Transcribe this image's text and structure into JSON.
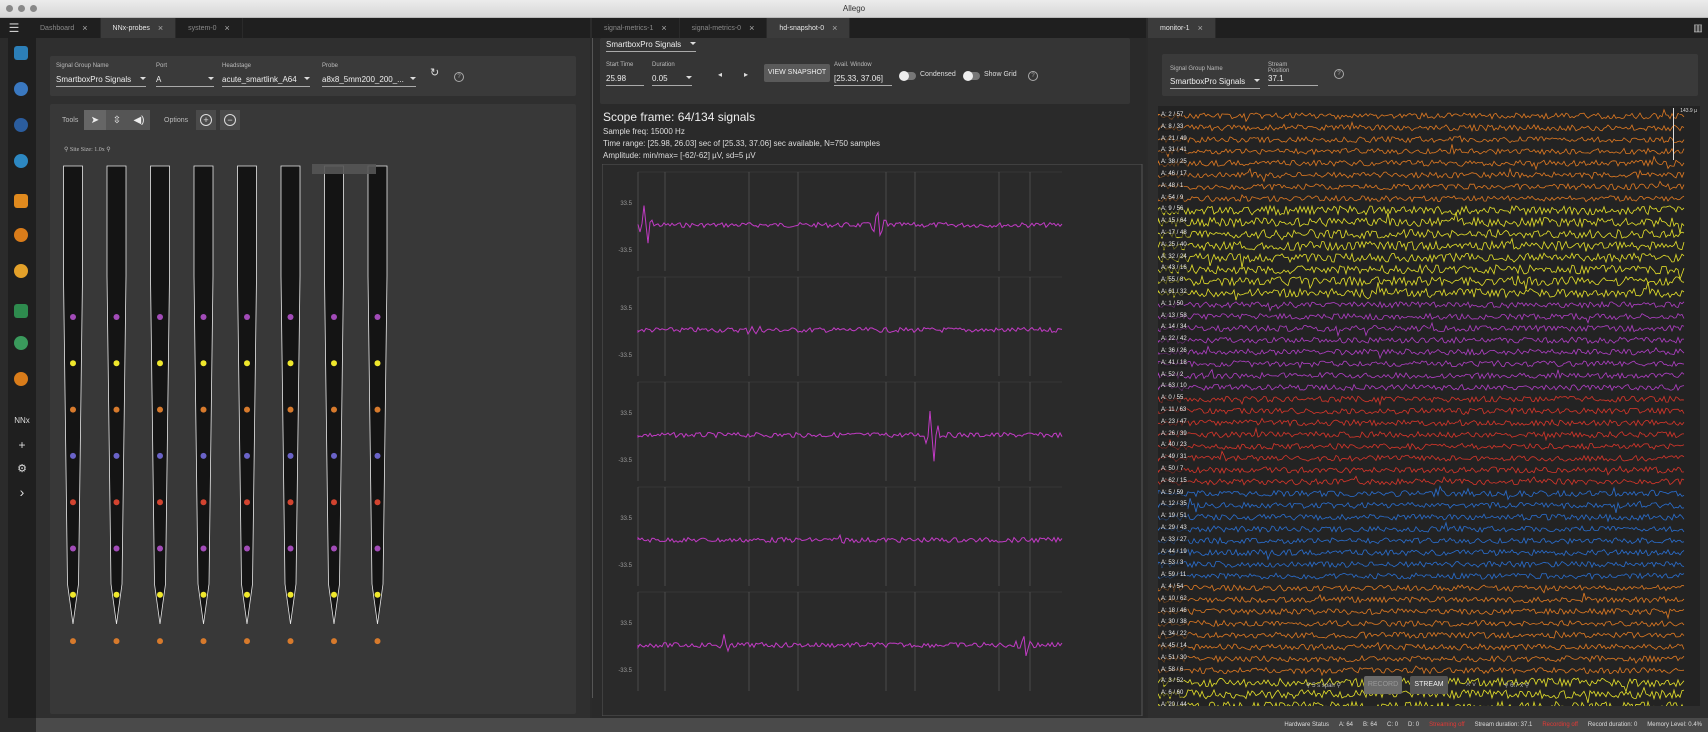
{
  "window": {
    "title": "Allego"
  },
  "tabs_left": [
    {
      "label": "Dashboard",
      "active": false
    },
    {
      "label": "NNx-probes",
      "active": true
    },
    {
      "label": "system-0",
      "active": false
    }
  ],
  "tabs_mid": [
    {
      "label": "signal-metrics-1",
      "active": false
    },
    {
      "label": "signal-metrics-0",
      "active": false
    },
    {
      "label": "hd-snapshot-0",
      "active": true
    }
  ],
  "tabs_right": [
    {
      "label": "monitor-1",
      "active": true
    }
  ],
  "sidebar": {
    "nnx_label": "NNx",
    "add_label": "+",
    "settings_label": "⚙",
    "expand_label": "›"
  },
  "probe_panel": {
    "signal_group_label": "Signal Group Name",
    "signal_group_value": "SmartboxPro Signals",
    "port_label": "Port",
    "port_value": "A",
    "headstage_label": "Headstage",
    "headstage_value": "acute_smartlink_A64",
    "probe_label": "Probe",
    "probe_value": "a8x8_5mm200_200_...",
    "tools_label": "Tools",
    "options_label": "Options",
    "site_size_label": "Site Size: 1.0x",
    "shank_count": 8,
    "site_colors": [
      "#a24bb8",
      "#f0e82c",
      "#d77a2c",
      "#6a63c8",
      "#d2432f",
      "#a24bb8",
      "#f0e82c",
      "#d77a2c"
    ]
  },
  "snapshot_panel": {
    "signal_group_value": "SmartboxPro Signals",
    "start_time_label": "Start Time",
    "start_time_value": "25.98",
    "duration_label": "Duration",
    "duration_value": "0.05",
    "view_snapshot_label": "VIEW SNAPSHOT",
    "avail_window_label": "Avail. Window",
    "avail_window_value": "[25.33, 37.06]",
    "condensed_label": "Condensed",
    "show_grid_label": "Show Grid",
    "scope_title": "Scope frame: 64/134 signals",
    "sample_freq": "Sample freq: 15000 Hz",
    "time_range": "Time range: [25.98, 26.03] sec of [25.33, 37.06] sec available, N=750 samples",
    "amplitude": "Amplitude: min/max= [-62/-62] µV, sd=5 µV",
    "y_tick_top": "33.5",
    "y_tick_bottom": "-33.5",
    "trace_color": "#c13bc4",
    "subplot_count": 5
  },
  "monitor_panel": {
    "signal_group_label": "Signal Group Name",
    "signal_group_value": "SmartboxPro Signals",
    "stream_position_label": "Stream Position",
    "stream_position_value": "37.1",
    "scale_top": "143.9 µ",
    "channels": [
      {
        "label": "A: 2 / 57",
        "color": "#e07a22"
      },
      {
        "label": "A: 8 / 33",
        "color": "#e07a22"
      },
      {
        "label": "A: 21 / 49",
        "color": "#e07a22"
      },
      {
        "label": "A: 31 / 41",
        "color": "#e07a22"
      },
      {
        "label": "A: 38 / 25",
        "color": "#e07a22"
      },
      {
        "label": "A: 46 / 17",
        "color": "#e07a22"
      },
      {
        "label": "A: 48 / 1",
        "color": "#e07a22"
      },
      {
        "label": "A: 54 / 9",
        "color": "#e07a22"
      },
      {
        "label": "A: 9 / 56",
        "color": "#e6e22a"
      },
      {
        "label": "A: 15 / 64",
        "color": "#e6e22a"
      },
      {
        "label": "A: 17 / 48",
        "color": "#e6e22a"
      },
      {
        "label": "A: 25 / 40",
        "color": "#e6e22a"
      },
      {
        "label": "A: 32 / 24",
        "color": "#e6e22a"
      },
      {
        "label": "A: 43 / 16",
        "color": "#e6e22a"
      },
      {
        "label": "A: 55 / 8",
        "color": "#e6e22a"
      },
      {
        "label": "A: 61 / 32",
        "color": "#e6e22a"
      },
      {
        "label": "A: 1 / 50",
        "color": "#b13fc6"
      },
      {
        "label": "A: 13 / 58",
        "color": "#b13fc6"
      },
      {
        "label": "A: 14 / 34",
        "color": "#b13fc6"
      },
      {
        "label": "A: 22 / 42",
        "color": "#b13fc6"
      },
      {
        "label": "A: 36 / 26",
        "color": "#b13fc6"
      },
      {
        "label": "A: 41 / 18",
        "color": "#b13fc6"
      },
      {
        "label": "A: 52 / 2",
        "color": "#b13fc6"
      },
      {
        "label": "A: 63 / 10",
        "color": "#b13fc6"
      },
      {
        "label": "A: 0 / 55",
        "color": "#d9362a"
      },
      {
        "label": "A: 11 / 63",
        "color": "#d9362a"
      },
      {
        "label": "A: 23 / 47",
        "color": "#d9362a"
      },
      {
        "label": "A: 26 / 39",
        "color": "#d9362a"
      },
      {
        "label": "A: 40 / 23",
        "color": "#d9362a"
      },
      {
        "label": "A: 49 / 31",
        "color": "#d9362a"
      },
      {
        "label": "A: 50 / 7",
        "color": "#d9362a"
      },
      {
        "label": "A: 62 / 15",
        "color": "#d9362a"
      },
      {
        "label": "A: 5 / 59",
        "color": "#2a6fd1"
      },
      {
        "label": "A: 12 / 35",
        "color": "#2a6fd1"
      },
      {
        "label": "A: 19 / 51",
        "color": "#2a6fd1"
      },
      {
        "label": "A: 29 / 43",
        "color": "#2a6fd1"
      },
      {
        "label": "A: 33 / 27",
        "color": "#2a6fd1"
      },
      {
        "label": "A: 44 / 19",
        "color": "#2a6fd1"
      },
      {
        "label": "A: 53 / 3",
        "color": "#2a6fd1"
      },
      {
        "label": "A: 59 / 11",
        "color": "#2a6fd1"
      },
      {
        "label": "A: 4 / 54",
        "color": "#e07a22"
      },
      {
        "label": "A: 10 / 62",
        "color": "#e07a22"
      },
      {
        "label": "A: 18 / 46",
        "color": "#e07a22"
      },
      {
        "label": "A: 30 / 38",
        "color": "#e07a22"
      },
      {
        "label": "A: 34 / 22",
        "color": "#e07a22"
      },
      {
        "label": "A: 45 / 14",
        "color": "#e07a22"
      },
      {
        "label": "A: 51 / 30",
        "color": "#e07a22"
      },
      {
        "label": "A: 58 / 6",
        "color": "#e07a22"
      },
      {
        "label": "A: 3 / 52",
        "color": "#e6e22a"
      },
      {
        "label": "A: 6 / 60",
        "color": "#e6e22a"
      },
      {
        "label": "A: 20 / 44",
        "color": "#e6e22a"
      }
    ],
    "time_zoom": "5 s span",
    "amp_zoom": "6.7 x",
    "record_label": "RECORD",
    "stream_label": "STREAM"
  },
  "status": {
    "hardware": "Hardware Status",
    "a": "A: 64",
    "b": "B: 64",
    "c": "C: 0",
    "d": "D: 0",
    "streaming": "Streaming off",
    "stream_duration": "Stream duration: 37.1",
    "recording": "Recording off",
    "record_duration": "Record duration: 0",
    "memory": "Memory Level: 0.4%"
  }
}
